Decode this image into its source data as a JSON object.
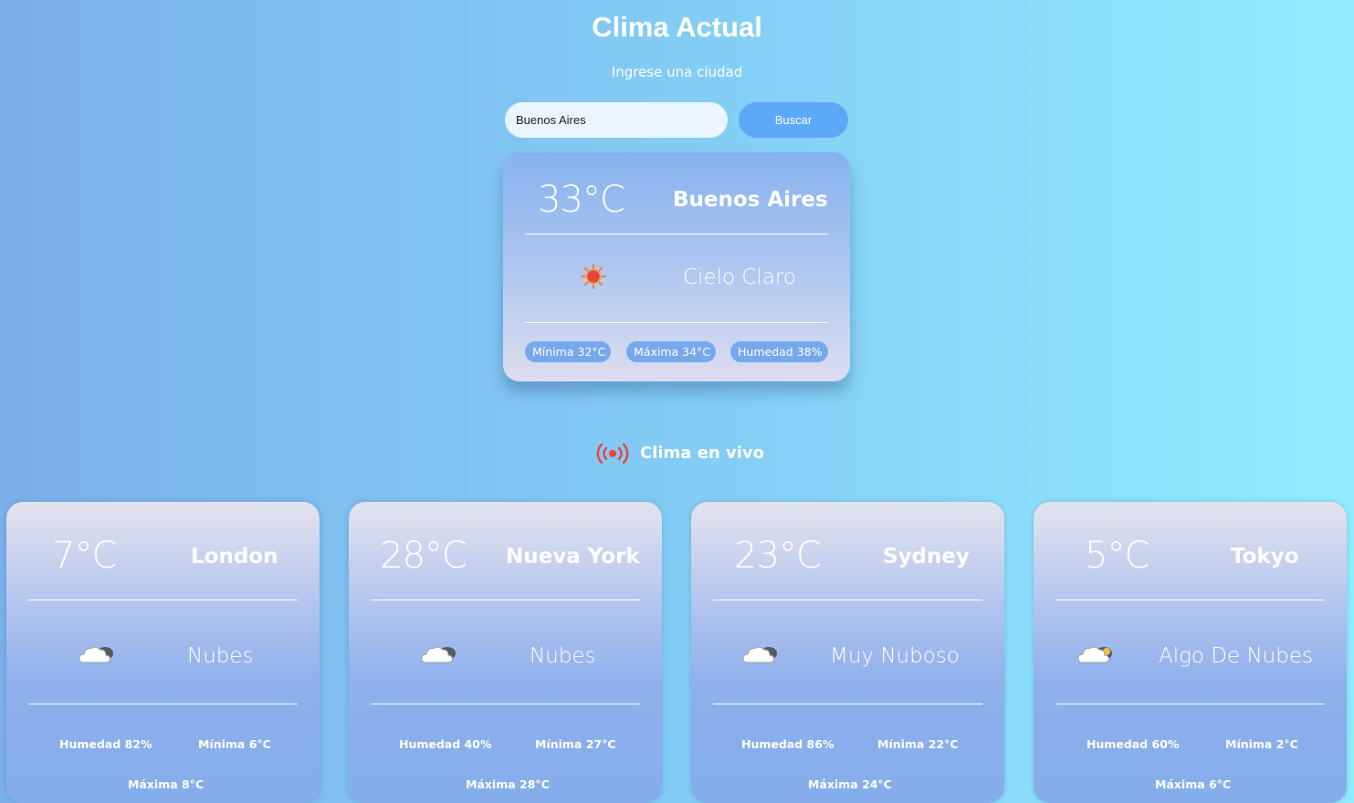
{
  "header": {
    "title": "Clima Actual",
    "subtitle": "Ingrese una ciudad"
  },
  "search": {
    "value": "Buenos Aires",
    "button_label": "Buscar"
  },
  "current": {
    "temperature": "33°C",
    "city": "Buenos Aires",
    "icon": "sun-icon",
    "description": "Cielo Claro",
    "min": "Mínima 32°C",
    "max": "Máxima 34°C",
    "humidity": "Humedad 38%"
  },
  "live": {
    "label": "Clima en vivo",
    "icon": "live-broadcast-icon"
  },
  "cities": [
    {
      "temperature": "7°C",
      "city": "London",
      "icon": "cloud-icon",
      "description": "Nubes",
      "humidity": "Humedad 82%",
      "min": "Mínima 6°C",
      "max": "Máxima 8°C"
    },
    {
      "temperature": "28°C",
      "city": "Nueva York",
      "icon": "cloud-icon",
      "description": "Nubes",
      "humidity": "Humedad 40%",
      "min": "Mínima 27°C",
      "max": "Máxima 28°C"
    },
    {
      "temperature": "23°C",
      "city": "Sydney",
      "icon": "cloud-icon",
      "description": "Muy Nuboso",
      "humidity": "Humedad 86%",
      "min": "Mínima 22°C",
      "max": "Máxima 24°C"
    },
    {
      "temperature": "5°C",
      "city": "Tokyo",
      "icon": "cloud-sun-icon",
      "description": "Algo De Nubes",
      "humidity": "Humedad 60%",
      "min": "Mínima 2°C",
      "max": "Máxima 6°C"
    }
  ],
  "colors": {
    "background_start": "#7bb0ea",
    "background_end": "#93ecfe",
    "button": "#5da9f8",
    "pill": "#75a8ec",
    "live_icon": "#e8453c"
  }
}
